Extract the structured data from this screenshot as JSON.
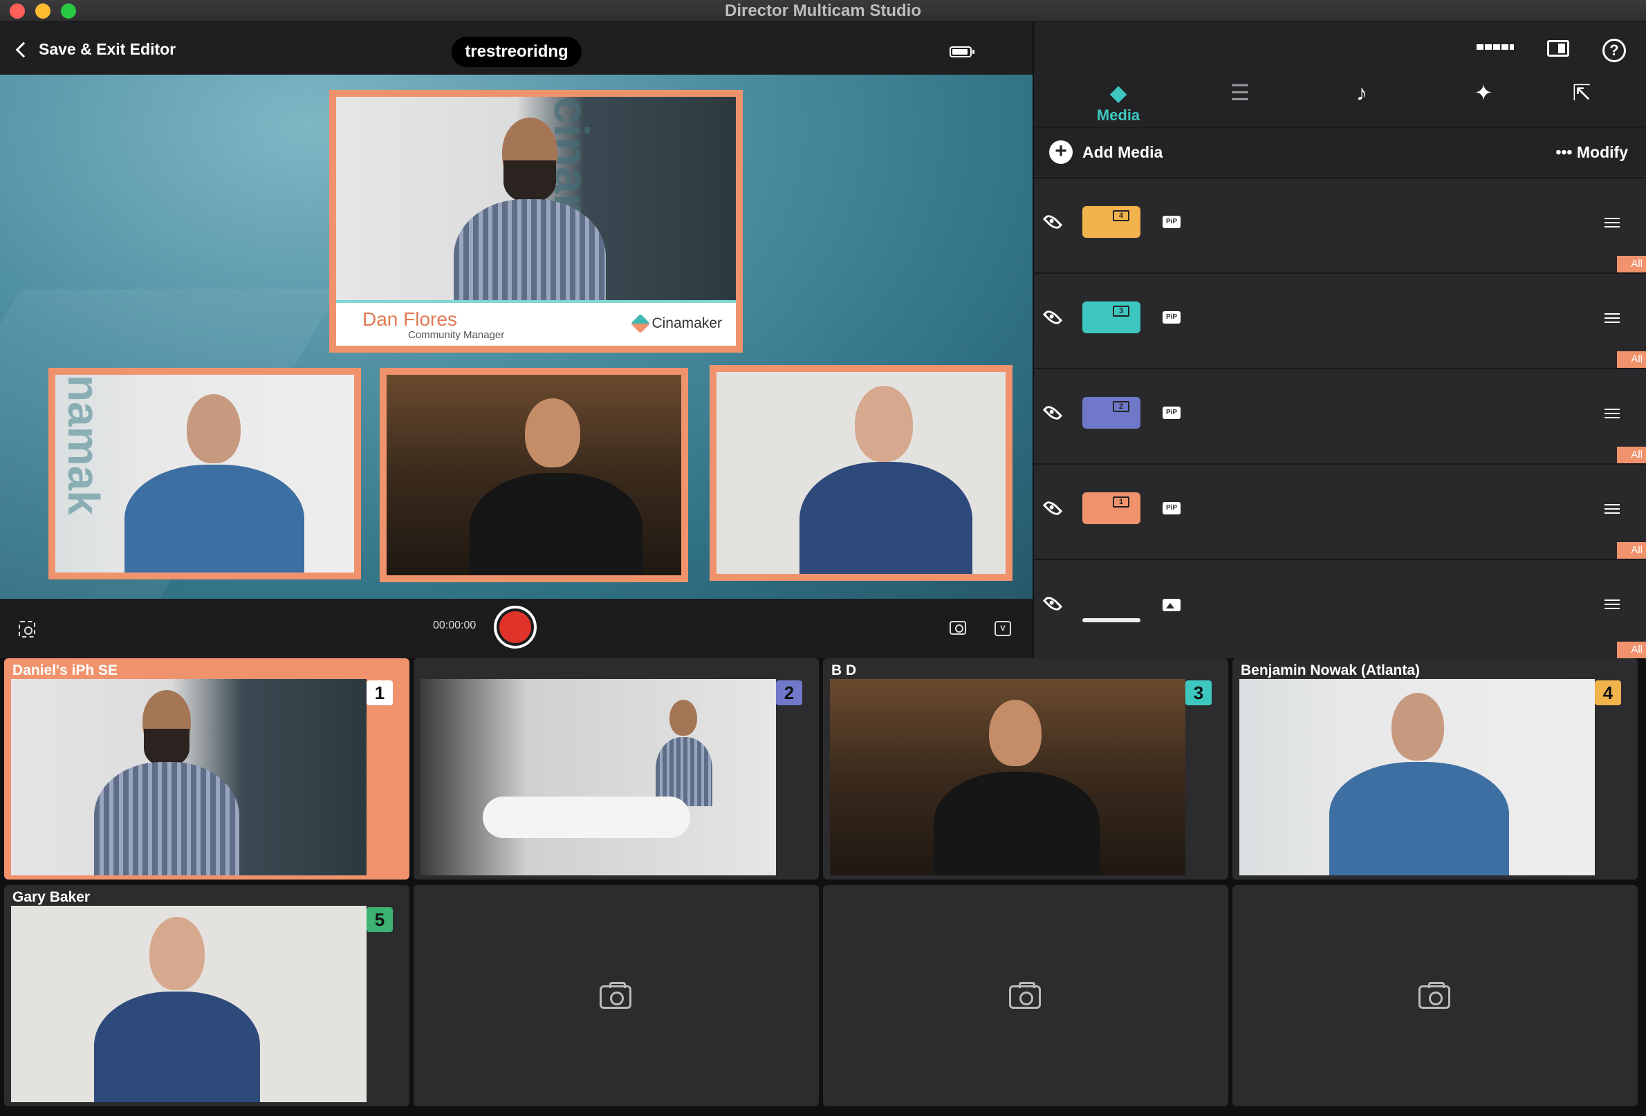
{
  "window": {
    "title": "Director Multicam Studio"
  },
  "editor": {
    "back_label": "Save & Exit Editor",
    "project_name": "trestreoridng"
  },
  "canvas": {
    "lower_third": {
      "name": "Dan Flores",
      "role": "Community Manager",
      "brand": "Cinamaker"
    },
    "banner_text": "cinamaker"
  },
  "transport": {
    "timer": "00:00:00"
  },
  "panel": {
    "tabs": [
      {
        "label": "Media",
        "icon": "layers-icon",
        "active": true
      },
      {
        "label": "",
        "icon": "sliders-icon",
        "active": false
      },
      {
        "label": "",
        "icon": "music-note-icon",
        "active": false
      },
      {
        "label": "",
        "icon": "magic-wand-icon",
        "active": false
      },
      {
        "label": "",
        "icon": "share-icon",
        "active": false
      }
    ],
    "add_media_label": "Add Media",
    "modify_label": "Modify",
    "layers": [
      {
        "number": "4",
        "color": "#f2b24c",
        "badge": "PiP",
        "scope": "All"
      },
      {
        "number": "3",
        "color": "#3ec7c0",
        "badge": "PiP",
        "scope": "All"
      },
      {
        "number": "2",
        "color": "#6f78c9",
        "badge": "PiP",
        "scope": "All"
      },
      {
        "number": "1",
        "color": "#f0936d",
        "badge": "PiP",
        "scope": "All"
      },
      {
        "number": "",
        "color": "#eeeeee",
        "badge": "image",
        "scope": "All"
      }
    ]
  },
  "cameras": [
    {
      "name": "Daniel's iPh SE",
      "number": "1",
      "badge_color": "#ffffff",
      "active": true
    },
    {
      "name": "",
      "number": "2",
      "badge_color": "#6f78c9",
      "active": false
    },
    {
      "name": "B D",
      "number": "3",
      "badge_color": "#3ec7c0",
      "active": false
    },
    {
      "name": "Benjamin Nowak (Atlanta)",
      "number": "4",
      "badge_color": "#f2b24c",
      "active": false
    },
    {
      "name": "Gary Baker",
      "number": "5",
      "badge_color": "#3cb371",
      "active": false
    },
    {
      "name": "",
      "number": "",
      "badge_color": "",
      "active": false
    },
    {
      "name": "",
      "number": "",
      "badge_color": "",
      "active": false
    },
    {
      "name": "",
      "number": "",
      "badge_color": "",
      "active": false
    }
  ]
}
